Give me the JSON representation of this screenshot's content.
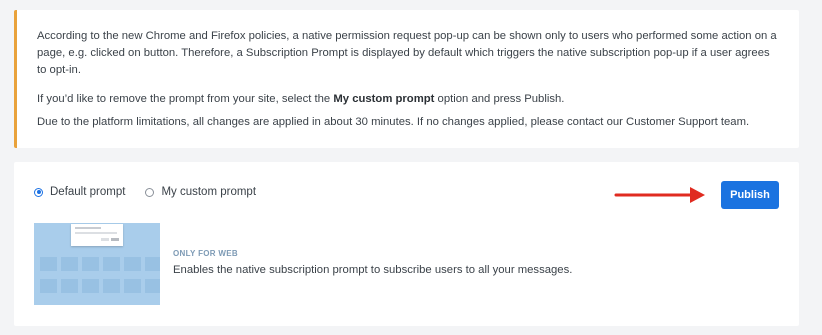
{
  "notice": {
    "paragraph1": "According to the new Chrome and Firefox policies, a native permission request pop-up can be shown only to users who performed some action on a page, e.g. clicked on button. Therefore, a Subscription Prompt is displayed by default which triggers the native subscription pop-up if a user agrees to opt-in.",
    "paragraph2_before": "If you’d like to remove the prompt from your site, select the ",
    "paragraph2_bold": "My custom prompt",
    "paragraph2_after": " option and press Publish.",
    "paragraph3": "Due to the platform limitations, all changes are applied in about 30 minutes. If no changes applied, please contact our Customer Support team.",
    "accent_color": "#e9a23b"
  },
  "prompt_options": {
    "default_label": "Default prompt",
    "custom_label": "My custom prompt",
    "selected": "Default prompt"
  },
  "publish": {
    "label": "Publish",
    "color": "#1b73e0"
  },
  "arrow": {
    "color": "#e02b20"
  },
  "info": {
    "tag": "ONLY FOR WEB",
    "description": "Enables the native subscription prompt to subscribe users to all your messages."
  }
}
